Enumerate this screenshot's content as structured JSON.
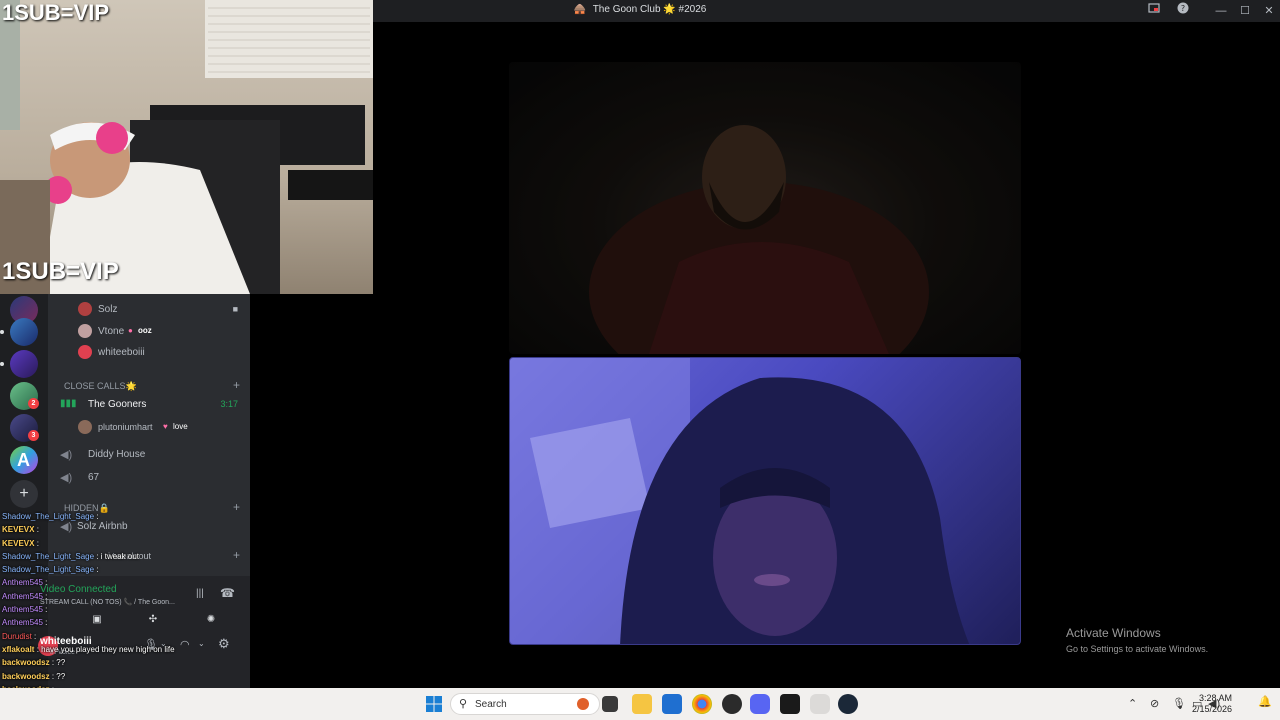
{
  "window": {
    "title": "The Goon Club 🌟 #2026",
    "title_icon": "🛖"
  },
  "stream_overlay": {
    "top_label": "1SUB=VIP",
    "bottom_label": "1SUB=VIP"
  },
  "servers": {
    "badges": [
      "2",
      "3"
    ]
  },
  "channels": {
    "voice_users_top": [
      {
        "name": "Solz"
      },
      {
        "name": "Vtone",
        "tag": "ooz"
      },
      {
        "name": "whiteeboiii"
      }
    ],
    "category_close_calls": "CLOSE CALLS🌟",
    "voice_channels": [
      {
        "name": "The Gooners",
        "time": "3:17"
      },
      {
        "name": "Diddy House"
      },
      {
        "name": "67"
      }
    ],
    "gooners_user": {
      "name": "plutoniumhart",
      "tag": "love"
    },
    "category_hidden": "HIDDEN🔒",
    "hidden_channels": [
      {
        "name": "Solz Airbnb"
      },
      {
        "name": "i tweak out"
      }
    ]
  },
  "voice_panel": {
    "status": "Video Connected",
    "detail": "STREAM CALL (NO TOS) 📞 / The Goon...",
    "username": "whiteeboiii",
    "user_status": "In Voice"
  },
  "chat": [
    {
      "user": "Shadow_The_Light_Sage",
      "msg": ":",
      "cls": "u2"
    },
    {
      "user": "KEVEVX",
      "msg": ":",
      "cls": "u1"
    },
    {
      "user": "KEVEVX",
      "msg": ":",
      "cls": "u1"
    },
    {
      "user": "Shadow_The_Light_Sage",
      "msg": ": i tweak out",
      "cls": "u2"
    },
    {
      "user": "Shadow_The_Light_Sage",
      "msg": ":",
      "cls": "u2"
    },
    {
      "user": "Anthem545",
      "msg": ":",
      "cls": "u3"
    },
    {
      "user": "Anthem545",
      "msg": ":",
      "cls": "u3"
    },
    {
      "user": "Anthem545",
      "msg": ":",
      "cls": "u3"
    },
    {
      "user": "Anthem545",
      "msg": ":",
      "cls": "u3"
    },
    {
      "user": "Durudist",
      "msg": ":",
      "cls": "u4"
    },
    {
      "user": "xflakoalt",
      "msg": ": have you played they new high on life",
      "cls": "msg"
    },
    {
      "user": "backwoodsz",
      "msg": ": ??",
      "cls": "msg"
    },
    {
      "user": "backwoodsz",
      "msg": ": ??",
      "cls": "msg"
    },
    {
      "user": "backwoodsz",
      "msg": ":",
      "cls": "u1"
    }
  ],
  "desktop": {
    "activate_title": "Activate Windows",
    "activate_sub": "Go to Settings to activate Windows."
  },
  "taskbar": {
    "search_placeholder": "Search",
    "time": "3:28 AM",
    "date": "2/15/2026"
  }
}
